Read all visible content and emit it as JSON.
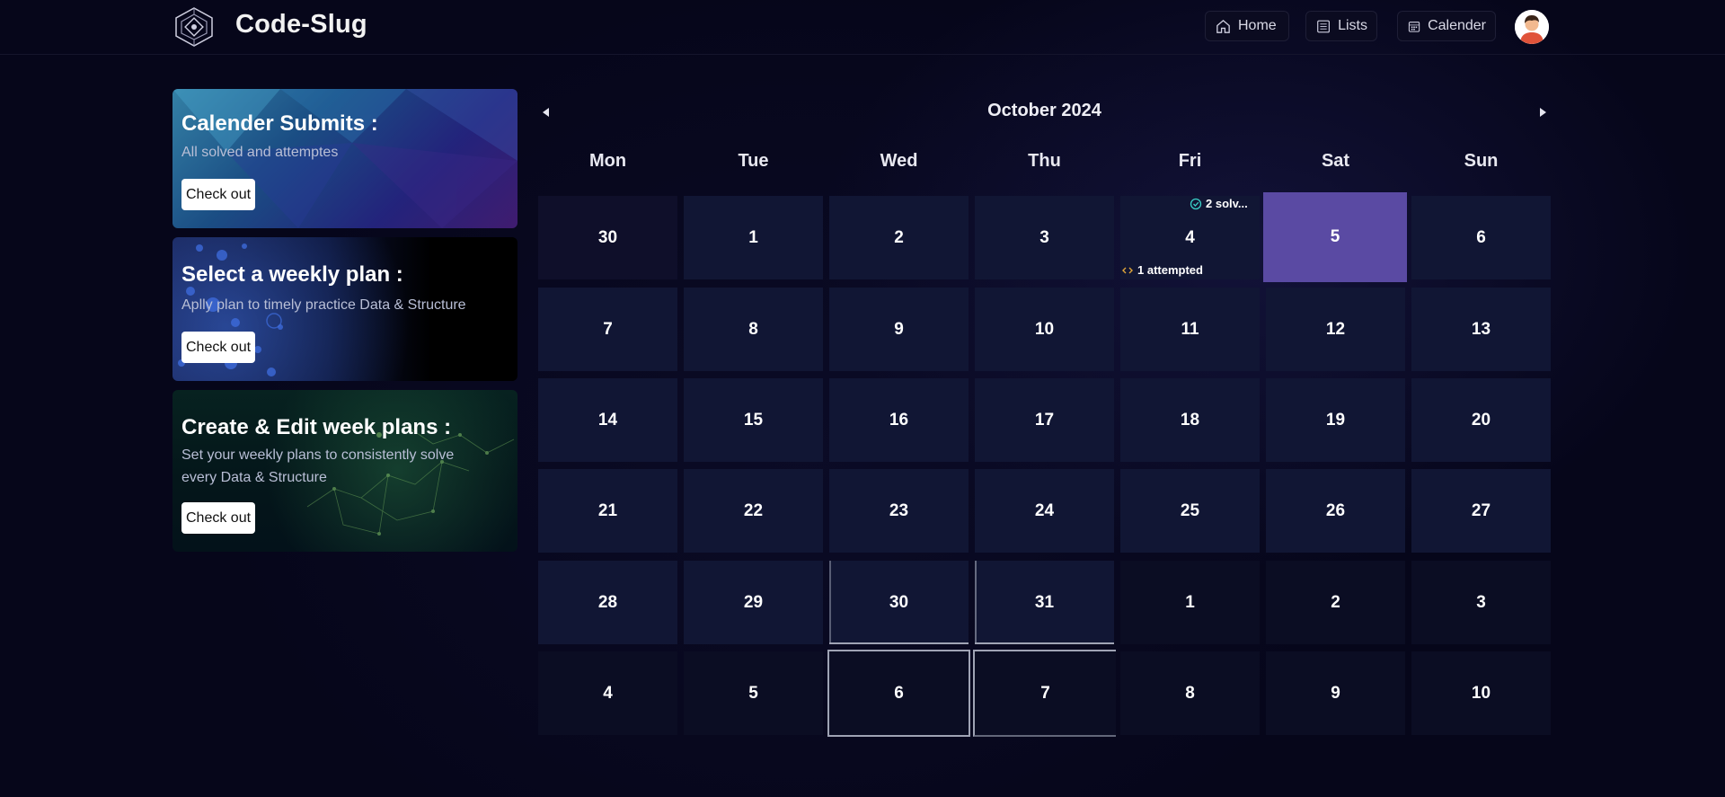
{
  "header": {
    "brand": "Code-Slug",
    "nav": [
      {
        "label": "Home",
        "icon": "home-icon"
      },
      {
        "label": "Lists",
        "icon": "list-icon"
      },
      {
        "label": "Calender",
        "icon": "calendar-icon"
      }
    ]
  },
  "cards": [
    {
      "title": "Calender Submits :",
      "subtitle": "All solved and attemptes",
      "button": "Check out"
    },
    {
      "title": "Select a weekly plan :",
      "subtitle": "Aplly plan to timely practice Data & Structure",
      "button": "Check out"
    },
    {
      "title": "Create & Edit week plans :",
      "subtitle_line1": "Set your weekly plans to consistently solve",
      "subtitle_line2": "every Data & Structure",
      "button": "Check out"
    }
  ],
  "calendar": {
    "month": "October 2024",
    "weekdays": [
      "Mon",
      "Tue",
      "Wed",
      "Thu",
      "Fri",
      "Sat",
      "Sun"
    ],
    "weeks": [
      [
        "30",
        "1",
        "2",
        "3",
        "4",
        "5",
        "6"
      ],
      [
        "7",
        "8",
        "9",
        "10",
        "11",
        "12",
        "13"
      ],
      [
        "14",
        "15",
        "16",
        "17",
        "18",
        "19",
        "20"
      ],
      [
        "21",
        "22",
        "23",
        "24",
        "25",
        "26",
        "27"
      ],
      [
        "28",
        "29",
        "30",
        "31",
        "1",
        "2",
        "3"
      ],
      [
        "4",
        "5",
        "6",
        "7",
        "8",
        "9",
        "10"
      ]
    ],
    "solved_label": "2 solv...",
    "attempted_label": "1 attempted",
    "today_color": "#5a4aa3"
  },
  "colors": {
    "background": "#06061a",
    "cell": "#111634",
    "cell_dim": "#0b0d23",
    "solved_check": "#3ad0c8",
    "attempted_icon": "#e0a63a"
  }
}
